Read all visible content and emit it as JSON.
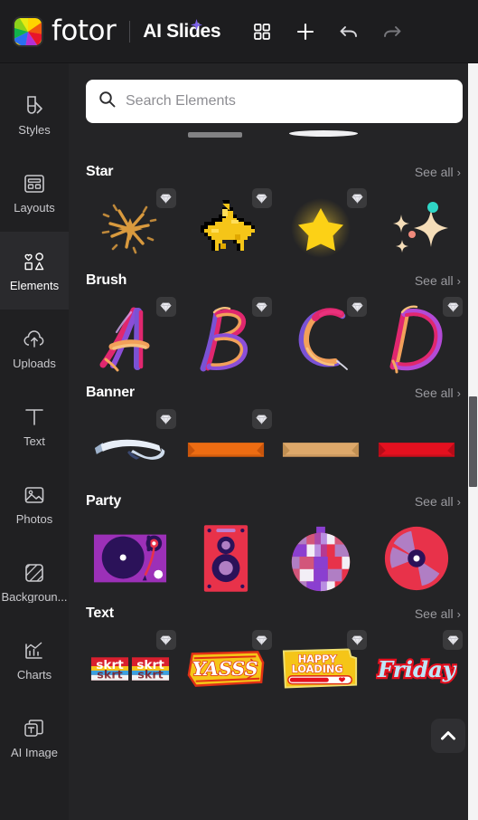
{
  "header": {
    "logo_icon": "fotor-pinwheel-logo",
    "brand": "fotor",
    "app_title": "AI Slides",
    "sparkle_icon": "sparkle-icon",
    "sparkle_color": "#7b61e8",
    "actions": [
      {
        "name": "grid-view-button",
        "icon": "grid-icon",
        "label": "Grid view"
      },
      {
        "name": "add-slide-button",
        "icon": "plus-icon",
        "label": "Add"
      },
      {
        "name": "undo-button",
        "icon": "undo-arrow-icon",
        "label": "Undo"
      },
      {
        "name": "redo-button",
        "icon": "redo-arrow-icon",
        "label": "Redo"
      }
    ]
  },
  "sidebar": {
    "active": "Elements",
    "items": [
      {
        "label": "Styles",
        "icon": "styles-icon"
      },
      {
        "label": "Layouts",
        "icon": "layouts-icon"
      },
      {
        "label": "Elements",
        "icon": "elements-icon"
      },
      {
        "label": "Uploads",
        "icon": "upload-cloud-icon"
      },
      {
        "label": "Text",
        "icon": "text-t-icon"
      },
      {
        "label": "Photos",
        "icon": "photos-icon"
      },
      {
        "label": "Backgroun...",
        "icon": "background-icon"
      },
      {
        "label": "Charts",
        "icon": "charts-icon"
      },
      {
        "label": "AI Image",
        "icon": "ai-image-icon"
      }
    ]
  },
  "search": {
    "placeholder": "Search Elements",
    "value": "",
    "icon": "search-icon"
  },
  "panel": {
    "see_all_label": "See all",
    "chevron": "›",
    "scroll_top_icon": "chevron-up-icon",
    "sections": [
      {
        "title": "Star",
        "items": [
          {
            "name": "sparkle-burst-element",
            "premium": true
          },
          {
            "name": "pixel-star-element",
            "premium": true
          },
          {
            "name": "glowing-star-element",
            "premium": true
          },
          {
            "name": "sparkles-cluster-element",
            "premium": false
          }
        ]
      },
      {
        "title": "Brush",
        "items": [
          {
            "name": "brush-letter-a",
            "letter": "A",
            "premium": true
          },
          {
            "name": "brush-letter-b",
            "letter": "B",
            "premium": true
          },
          {
            "name": "brush-letter-c",
            "letter": "C",
            "premium": true
          },
          {
            "name": "brush-letter-d",
            "letter": "D",
            "premium": true
          }
        ]
      },
      {
        "title": "Banner",
        "items": [
          {
            "name": "white-ribbon-banner",
            "color": "#dfe7f2",
            "premium": true
          },
          {
            "name": "orange-ribbon-banner",
            "color": "#ed6c12",
            "premium": true
          },
          {
            "name": "tan-ribbon-banner",
            "color": "#dda86a",
            "premium": false
          },
          {
            "name": "red-ribbon-banner",
            "color": "#e4101f",
            "premium": false
          }
        ]
      },
      {
        "title": "Party",
        "items": [
          {
            "name": "turntable-element",
            "premium": false
          },
          {
            "name": "speaker-element",
            "premium": false
          },
          {
            "name": "disco-ball-element",
            "premium": false
          },
          {
            "name": "vinyl-record-element",
            "premium": false
          }
        ]
      },
      {
        "title": "Text",
        "items": [
          {
            "name": "skrt-skrt-sticker",
            "text": "skrt skrt",
            "premium": true
          },
          {
            "name": "yasss-sticker",
            "text": "YASSS",
            "premium": true
          },
          {
            "name": "happy-loading-sticker",
            "text": "HAPPY LOADING",
            "premium": true
          },
          {
            "name": "friday-sticker",
            "text": "Friday",
            "premium": true
          }
        ]
      }
    ]
  },
  "colors": {
    "panel_bg": "#242426",
    "sidebar_bg": "#202022",
    "header_bg": "#1d1d1f",
    "badge_bg": "#3a3a3c",
    "accent_purple": "#7b61e8"
  },
  "scrollbar": {
    "name": "panel-scrollbar",
    "thumb_top_pct": 44,
    "thumb_height_pct": 12
  }
}
